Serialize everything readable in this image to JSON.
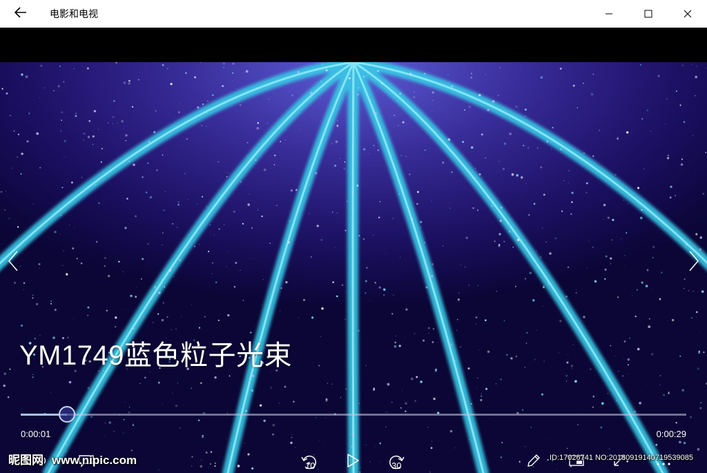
{
  "app": {
    "title": "电影和电视"
  },
  "video": {
    "title": "YM1749蓝色粒子光束",
    "current_time": "0:00:01",
    "total_time": "0:00:29",
    "progress": 0.07
  },
  "controls": {
    "skip_back_seconds": "10",
    "skip_forward_seconds": "30"
  },
  "watermark": {
    "logo_text": "昵图网",
    "site": "www.nipic.com",
    "id_text": "ID:17026741 NO:20180919140719539085"
  },
  "icons": {
    "back": "arrow-left-icon",
    "minimize": "minimize-icon",
    "maximize": "maximize-icon",
    "close": "close-icon",
    "prev": "chevron-left-icon",
    "next": "chevron-right-icon",
    "volume": "volume-icon",
    "subtitles": "subtitles-icon",
    "rewind": "skip-back-10-icon",
    "play": "play-icon",
    "forward": "skip-forward-30-icon",
    "edit": "pen-icon",
    "miniview": "mini-view-icon",
    "fullscreen": "fullscreen-icon",
    "more": "more-icon"
  },
  "colors": {
    "titlebar_bg": "#ffffff",
    "seek_fill": "#a9c4ef",
    "video_bg": "#1a0f66"
  }
}
